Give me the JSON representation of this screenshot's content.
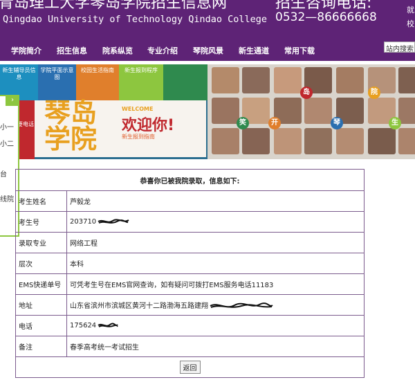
{
  "header": {
    "title": "青岛理工大学琴岛学院招生信息网",
    "subtitle": "Qingdao University of Technology Qindao College",
    "phone_label": "招生咨询电话:",
    "phone": "0532—86666668",
    "right_top": "就",
    "right_bottom": "校"
  },
  "nav": {
    "items": [
      "学院简介",
      "招生信息",
      "院系纵览",
      "专业介绍",
      "琴院风景",
      "新生通道",
      "常用下载"
    ],
    "search_label": "站内搜索"
  },
  "banner": {
    "tiles": [
      "新生辅导员信息",
      "学院平面示意图",
      "校园生活指南",
      "新生报到程序",
      "学生主要电话"
    ],
    "school_name_1": "琴岛",
    "school_name_2": "学院",
    "welcome_en": "WELCOME",
    "welcome_cn": "欢迎你!",
    "new_student_guide": "新生报到指南",
    "badges": [
      "笑",
      "开",
      "琴",
      "生",
      "岛",
      "院"
    ]
  },
  "side_panel": {
    "toggle_icon": "chevron-right-icon",
    "items": [
      "小一",
      "小二",
      "台",
      "线院"
    ]
  },
  "admission": {
    "heading": "恭喜你已被我院录取，信息如下:",
    "rows": [
      {
        "label": "考生姓名",
        "value": "芦毅龙"
      },
      {
        "label": "考生号",
        "value": "203710"
      },
      {
        "label": "录取专业",
        "value": "网络工程"
      },
      {
        "label": "层次",
        "value": "本科"
      },
      {
        "label": "EMS快递单号",
        "value": "可凭考生号在EMS官网查询，如有疑问可拨打EMS服务电话11183"
      },
      {
        "label": "地址",
        "value": "山东省滨州市滨城区黄河十二路渤海五路建翔"
      },
      {
        "label": "电话",
        "value": "175624"
      },
      {
        "label": "备注",
        "value": "春季高考统一考试招生"
      }
    ],
    "back_button": "返回"
  },
  "colors": {
    "header_bg": "#5e2376",
    "side_border": "#8dc63f",
    "table_border": "#7a5a8c",
    "accent_orange": "#e8a020",
    "accent_red": "#c0282e"
  }
}
